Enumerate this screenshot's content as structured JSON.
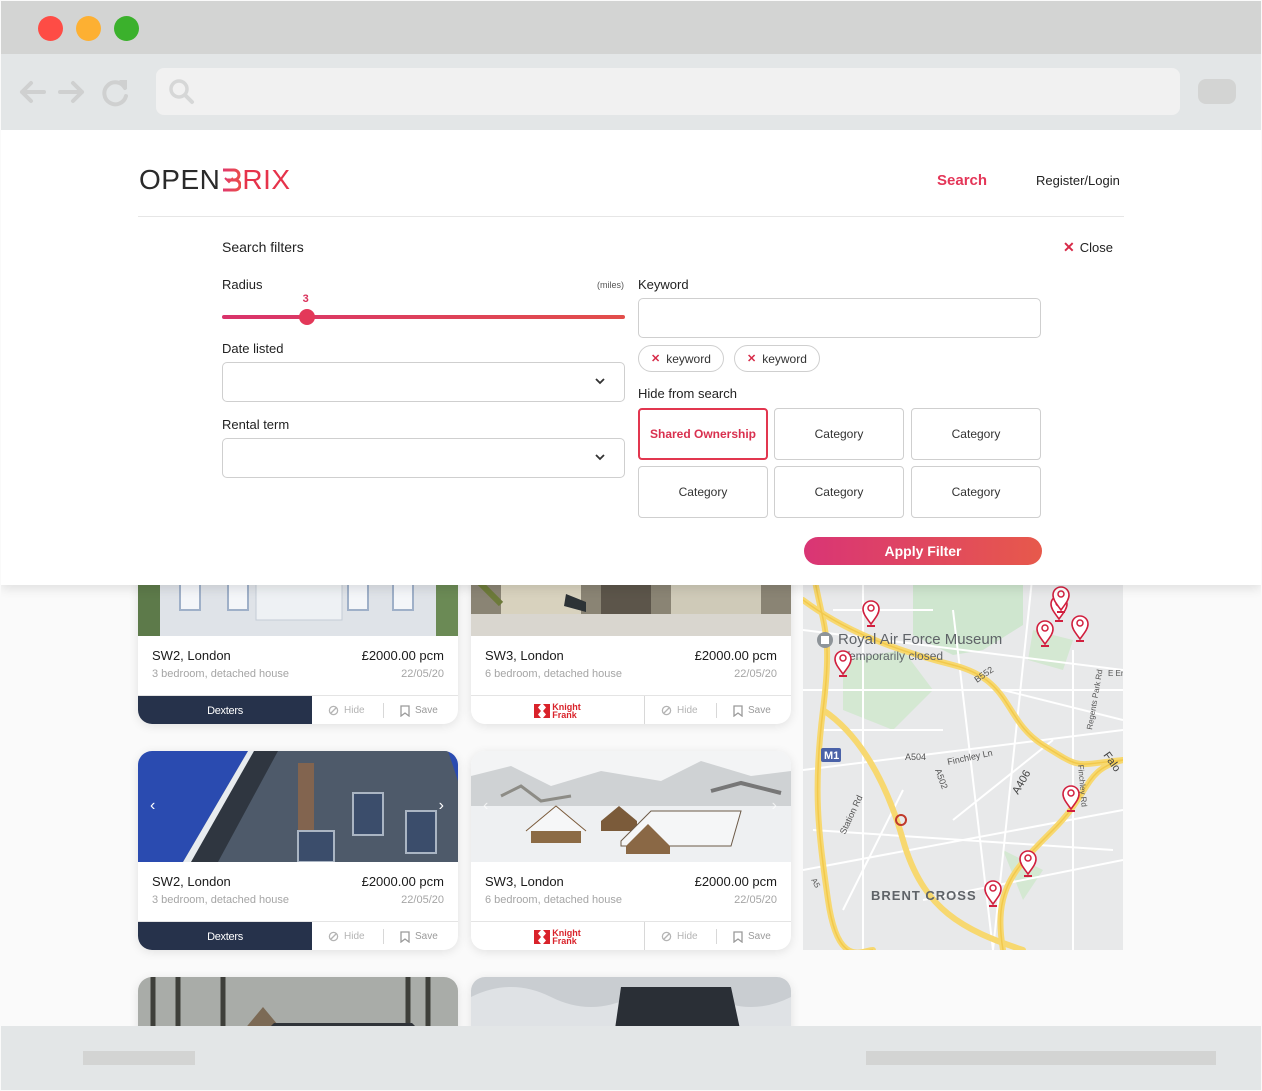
{
  "browser": {
    "window_controls": [
      "close",
      "minimize",
      "maximize"
    ],
    "nav_icons": [
      "back-arrow-icon",
      "forward-arrow-icon",
      "reload-icon"
    ],
    "address_bar": {
      "value": "",
      "icon": "search-icon"
    }
  },
  "header": {
    "logo_open": "OPEN",
    "logo_brix": "RIX",
    "nav": {
      "search": "Search",
      "register_login": "Register/Login"
    },
    "colors": {
      "accent": "#e43658",
      "dark": "#26324b"
    }
  },
  "filters": {
    "title": "Search filters",
    "close_label": "Close",
    "radius": {
      "label": "Radius",
      "unit": "(miles)",
      "value": "3",
      "fraction": 0.21
    },
    "date_listed": {
      "label": "Date listed",
      "value": ""
    },
    "rental_term": {
      "label": "Rental term",
      "value": ""
    },
    "keyword": {
      "label": "Keyword",
      "value": "",
      "chips": [
        "keyword",
        "keyword"
      ]
    },
    "hide_from_search": {
      "label": "Hide from search",
      "categories": [
        {
          "label": "Shared Ownership",
          "selected": true
        },
        {
          "label": "Category",
          "selected": false
        },
        {
          "label": "Category",
          "selected": false
        },
        {
          "label": "Category",
          "selected": false
        },
        {
          "label": "Category",
          "selected": false
        },
        {
          "label": "Category",
          "selected": false
        }
      ]
    },
    "apply_label": "Apply Filter"
  },
  "listings": [
    {
      "location": "SW2, London",
      "price": "£2000.00 pcm",
      "description": "3 bedroom, detached house",
      "date": "22/05/20",
      "agent": "Dexters",
      "hide": "Hide",
      "save": "Save"
    },
    {
      "location": "SW3, London",
      "price": "£2000.00 pcm",
      "description": "6 bedroom, detached house",
      "date": "22/05/20",
      "agent": "Knight Frank",
      "hide": "Hide",
      "save": "Save"
    },
    {
      "location": "SW2, London",
      "price": "£2000.00 pcm",
      "description": "3 bedroom, detached house",
      "date": "22/05/20",
      "agent": "Dexters",
      "hide": "Hide",
      "save": "Save"
    },
    {
      "location": "SW3, London",
      "price": "£2000.00 pcm",
      "description": "6 bedroom, detached house",
      "date": "22/05/20",
      "agent": "Knight Frank",
      "hide": "Hide",
      "save": "Save"
    }
  ],
  "agents": {
    "knight_frank_line1": "Knight",
    "knight_frank_line2": "Frank"
  },
  "map": {
    "labels": {
      "poi": "Royal Air Force Museum",
      "poi_status": "Temporarily closed",
      "area": "BRENT CROSS",
      "motorway": "M1",
      "roads": [
        "B552",
        "A504",
        "Finchley Ln",
        "A502",
        "A406",
        "Station Rd",
        "Regents Park Rd",
        "Finchley Rd",
        "A5",
        "E En",
        "Falo"
      ]
    },
    "pin_count": 9
  }
}
